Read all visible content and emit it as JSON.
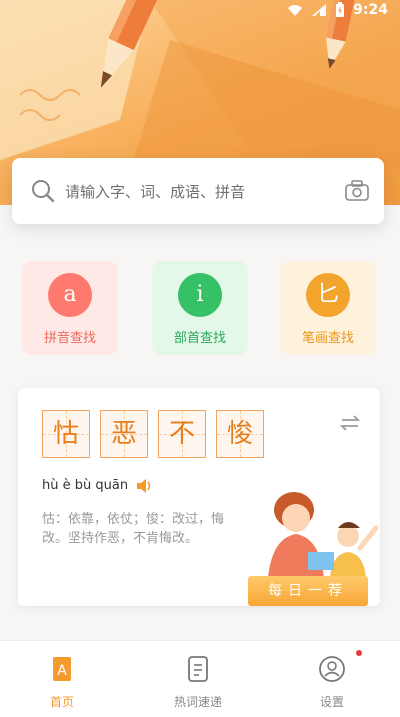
{
  "status": {
    "time": "9:24"
  },
  "search": {
    "placeholder": "请输入字、词、成语、拼音"
  },
  "lookup": {
    "pinyin": {
      "glyph": "a",
      "label": "拼音查找",
      "color": "#ff7a6e"
    },
    "radical": {
      "glyph": "i",
      "label": "部首查找",
      "color": "#37c166"
    },
    "stroke": {
      "glyph": "匕",
      "label": "笔画查找",
      "color": "#f2a42c"
    }
  },
  "recommend": {
    "chars": [
      "怙",
      "恶",
      "不",
      "悛"
    ],
    "pinyin": "hù è bù quān",
    "meaning": "怙：依靠，依仗；悛：改过，悔改。坚持作恶，不肯悔改。",
    "badge": "每日一荐"
  },
  "tabs": [
    {
      "label": "首页",
      "active": true
    },
    {
      "label": "热词速递",
      "active": false
    },
    {
      "label": "设置",
      "active": false
    }
  ],
  "colors": {
    "accent": "#f59b2e",
    "tab_inactive": "#888888",
    "settings_dot": "#e53935"
  }
}
